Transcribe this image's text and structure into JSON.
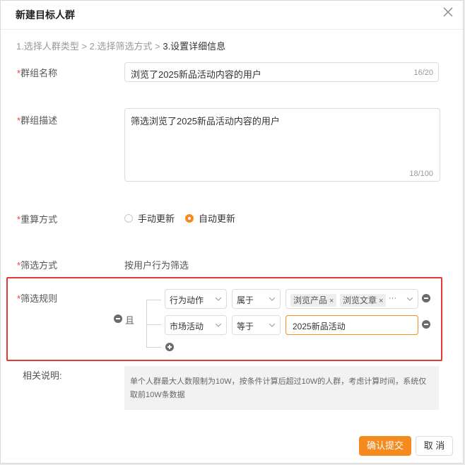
{
  "dialog": {
    "title": "新建目标人群"
  },
  "steps": {
    "step1": "1.选择人群类型",
    "sep1": " > ",
    "step2": "2.选择筛选方式",
    "sep2": " > ",
    "step3": "3.设置详细信息"
  },
  "form": {
    "required_mark": "*",
    "name": {
      "label": "群组名称",
      "value": "浏览了2025新品活动内容的用户",
      "count": "16/20"
    },
    "description": {
      "label": "群组描述",
      "value": "筛选浏览了2025新品活动内容的用户",
      "count": "18/100"
    },
    "recalc": {
      "label": "重算方式",
      "options": [
        "手动更新",
        "自动更新"
      ],
      "selected": "自动更新"
    },
    "filter_method": {
      "label": "筛选方式",
      "value": "按用户行为筛选"
    },
    "filter_rules": {
      "label": "筛选规则",
      "logic": "且",
      "rows": [
        {
          "field": "行为动作",
          "operator": "属于",
          "tags": [
            "浏览产品",
            "浏览文章"
          ],
          "more": "···"
        },
        {
          "field": "市场活动",
          "operator": "等于",
          "value": "2025新品活动"
        }
      ]
    },
    "notes": {
      "label": "相关说明:",
      "text": "单个人群最大人数限制为10W，按条件计算后超过10W的人群，考虑计算时间，系统仅取前10W条数据"
    }
  },
  "footer": {
    "submit": "确认提交",
    "cancel": "取 消"
  },
  "colors": {
    "accent": "#f58a1f",
    "required": "#f44336",
    "highlight_border": "#e53935"
  },
  "icons": [
    "close-icon",
    "chevron-down-icon",
    "remove-condition-icon",
    "add-condition-icon",
    "logic-toggle-icon"
  ]
}
